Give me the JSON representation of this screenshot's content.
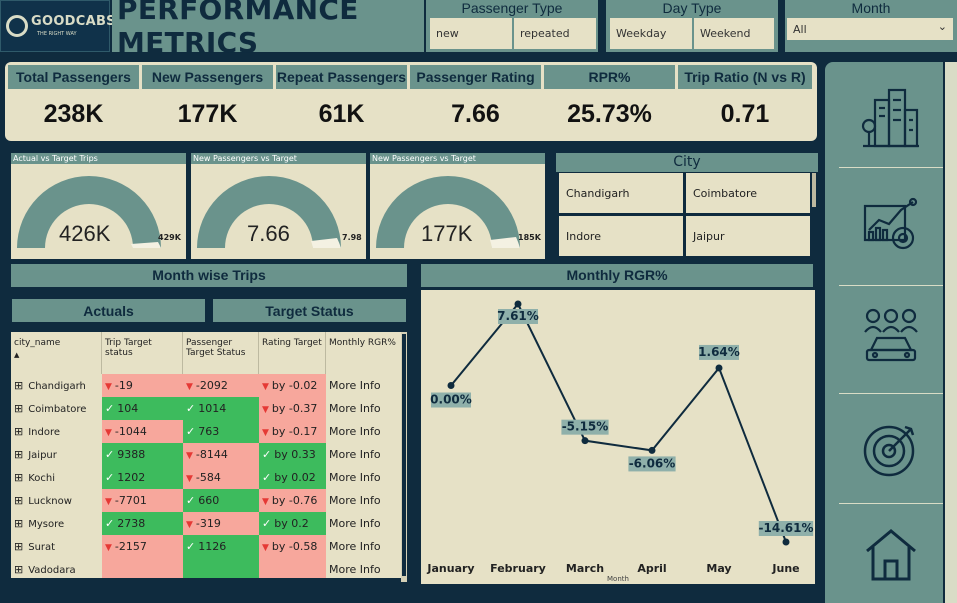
{
  "brand": {
    "name": "GOODCABS",
    "tagline": "THE RIGHT WAY"
  },
  "title": "PERFORMANCE METRICS",
  "filters": {
    "passenger_type": {
      "label": "Passenger Type",
      "options": [
        "new",
        "repeated"
      ]
    },
    "day_type": {
      "label": "Day Type",
      "options": [
        "Weekday",
        "Weekend"
      ]
    },
    "month": {
      "label": "Month",
      "value": "All"
    }
  },
  "kpis": [
    {
      "label": "Total Passengers",
      "value": "238K"
    },
    {
      "label": "New Passengers",
      "value": "177K"
    },
    {
      "label": "Repeat Passengers",
      "value": "61K"
    },
    {
      "label": "Passenger Rating",
      "value": "7.66"
    },
    {
      "label": "RPR%",
      "value": "25.73%"
    },
    {
      "label": "Trip Ratio (N vs R)",
      "value": "0.71"
    }
  ],
  "gauges": [
    {
      "title": "Actual vs Target Trips",
      "value": "426K",
      "target": "429K",
      "fraction": 0.993
    },
    {
      "title": "New Passengers vs Target",
      "value": "7.66",
      "target": "7.98",
      "fraction": 0.96
    },
    {
      "title": "New Passengers vs Target",
      "value": "177K",
      "target": "185K",
      "fraction": 0.957
    }
  ],
  "city_slicer": {
    "title": "City",
    "items": [
      "Chandigarh",
      "Coimbatore",
      "Indore",
      "Jaipur"
    ]
  },
  "month_wise": {
    "title": "Month wise Trips",
    "buttons": [
      "Actuals",
      "Target Status"
    ]
  },
  "table": {
    "columns": [
      "city_name",
      "Trip Target status",
      "Passenger Target Status",
      "Rating Target",
      "Monthly RGR%"
    ],
    "rows": [
      {
        "city": "Chandigarh",
        "trip": "-19",
        "trip_ok": false,
        "pass": "-2092",
        "pass_ok": false,
        "rating": "by -0.02",
        "rating_ok": false,
        "more": "More Info"
      },
      {
        "city": "Coimbatore",
        "trip": "104",
        "trip_ok": true,
        "pass": "1014",
        "pass_ok": true,
        "rating": "by -0.37",
        "rating_ok": false,
        "more": "More Info"
      },
      {
        "city": "Indore",
        "trip": "-1044",
        "trip_ok": false,
        "pass": "763",
        "pass_ok": true,
        "rating": "by -0.17",
        "rating_ok": false,
        "more": "More Info"
      },
      {
        "city": "Jaipur",
        "trip": "9388",
        "trip_ok": true,
        "pass": "-8144",
        "pass_ok": false,
        "rating": "by 0.33",
        "rating_ok": true,
        "more": "More Info"
      },
      {
        "city": "Kochi",
        "trip": "1202",
        "trip_ok": true,
        "pass": "-584",
        "pass_ok": false,
        "rating": "by 0.02",
        "rating_ok": true,
        "more": "More Info"
      },
      {
        "city": "Lucknow",
        "trip": "-7701",
        "trip_ok": false,
        "pass": "660",
        "pass_ok": true,
        "rating": "by -0.76",
        "rating_ok": false,
        "more": "More Info"
      },
      {
        "city": "Mysore",
        "trip": "2738",
        "trip_ok": true,
        "pass": "-319",
        "pass_ok": false,
        "rating": "by 0.2",
        "rating_ok": true,
        "more": "More Info"
      },
      {
        "city": "Surat",
        "trip": "-2157",
        "trip_ok": false,
        "pass": "1126",
        "pass_ok": true,
        "rating": "by -0.58",
        "rating_ok": false,
        "more": "More Info"
      },
      {
        "city": "Vadodara",
        "trip": "",
        "trip_ok": false,
        "pass": "",
        "pass_ok": true,
        "rating": "",
        "rating_ok": false,
        "more": "More Info"
      }
    ]
  },
  "chart_data": {
    "type": "line",
    "title": "Monthly RGR%",
    "xlabel": "Month",
    "categories": [
      "January",
      "February",
      "March",
      "April",
      "May",
      "June"
    ],
    "values": [
      0.0,
      7.61,
      -5.15,
      -6.06,
      1.64,
      -14.61
    ],
    "labels": [
      "0.00%",
      "7.61%",
      "-5.15%",
      "-6.06%",
      "1.64%",
      "-14.61%"
    ]
  },
  "sidebar": [
    "city-buildings-icon",
    "analytics-icon",
    "passengers-car-icon",
    "target-icon",
    "home-icon"
  ],
  "colors": {
    "navy": "#0f2b3e",
    "teal": "#6a938c",
    "cream": "#e6e1c6",
    "red": "#f7a79c",
    "green": "#3dbb5d"
  }
}
